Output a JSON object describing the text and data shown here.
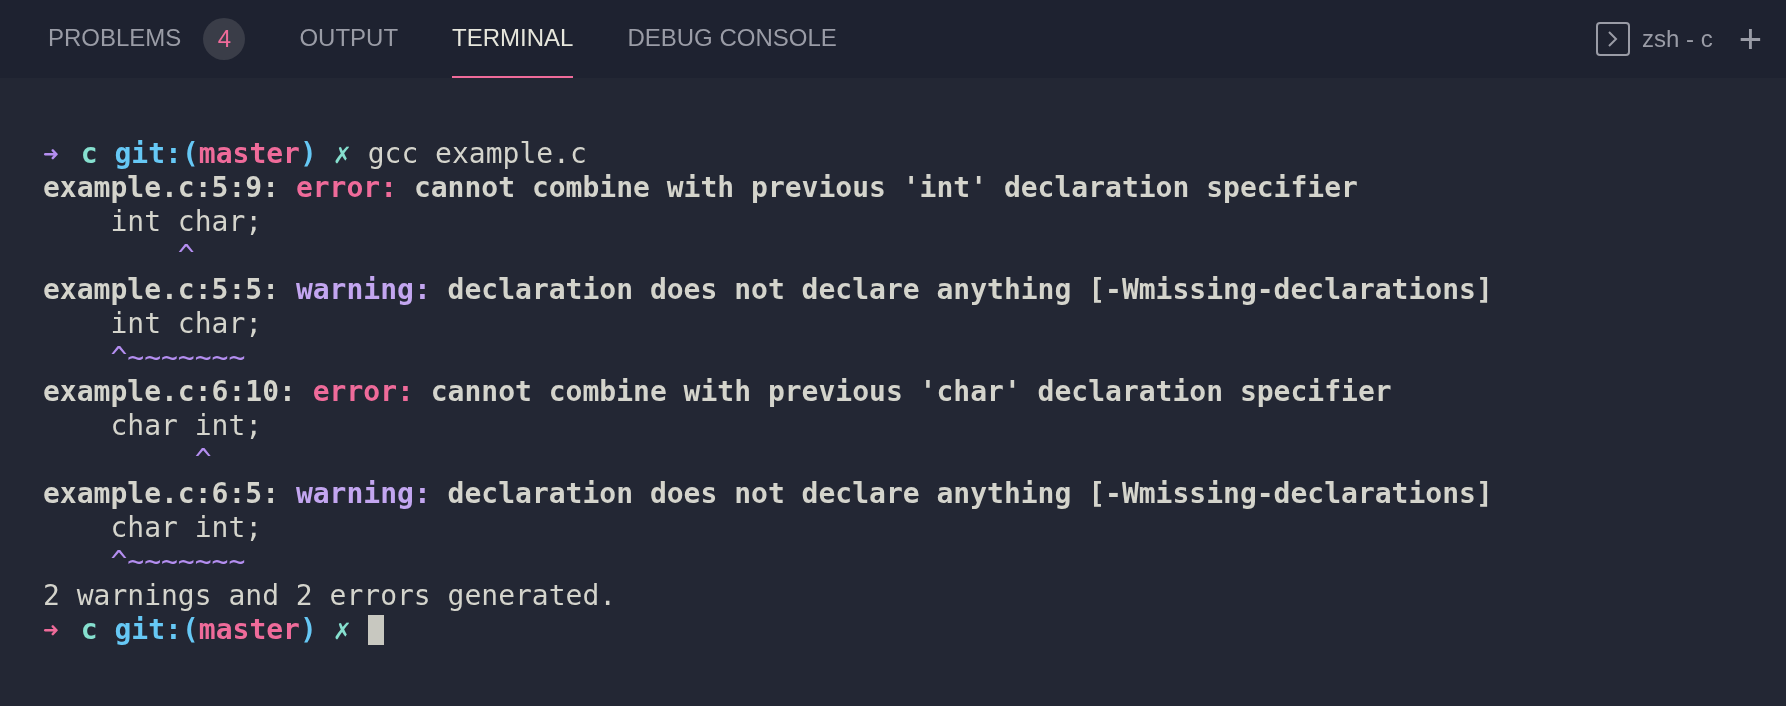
{
  "tabs": [
    {
      "label": "PROBLEMS",
      "badge": "4",
      "selected": false
    },
    {
      "label": "OUTPUT",
      "selected": false
    },
    {
      "label": "TERMINAL",
      "selected": true
    },
    {
      "label": "DEBUG CONSOLE",
      "selected": false
    }
  ],
  "terminal_selector": {
    "label": "zsh - c",
    "add": "+"
  },
  "terminal": {
    "lines": [
      {
        "kind": "prompt",
        "succeeded": true,
        "arrow": "➜",
        "directory": "c",
        "git_open": "git:(",
        "branch": "master",
        "git_close": ")",
        "dirty": "✗",
        "command": "gcc example.c"
      },
      {
        "kind": "output",
        "segments": [
          {
            "kind": "bold",
            "text": "example.c:5:9: "
          },
          {
            "kind": "error",
            "text": "error: "
          },
          {
            "kind": "bold",
            "text": "cannot combine with previous 'int' declaration specifier"
          }
        ]
      },
      {
        "kind": "output",
        "segments": [
          {
            "kind": "plain",
            "text": "    int char;"
          }
        ]
      },
      {
        "kind": "output",
        "segments": [
          {
            "kind": "marker",
            "text": "        ^"
          }
        ]
      },
      {
        "kind": "output",
        "segments": [
          {
            "kind": "bold",
            "text": "example.c:5:5: "
          },
          {
            "kind": "warning",
            "text": "warning: "
          },
          {
            "kind": "bold",
            "text": "declaration does not declare anything [-Wmissing-declarations]"
          }
        ]
      },
      {
        "kind": "output",
        "segments": [
          {
            "kind": "plain",
            "text": "    int char;"
          }
        ]
      },
      {
        "kind": "output",
        "segments": [
          {
            "kind": "marker",
            "text": "    ^~~~~~~~"
          }
        ]
      },
      {
        "kind": "output",
        "segments": [
          {
            "kind": "bold",
            "text": "example.c:6:10: "
          },
          {
            "kind": "error",
            "text": "error: "
          },
          {
            "kind": "bold",
            "text": "cannot combine with previous 'char' declaration specifier"
          }
        ]
      },
      {
        "kind": "output",
        "segments": [
          {
            "kind": "plain",
            "text": "    char int;"
          }
        ]
      },
      {
        "kind": "output",
        "segments": [
          {
            "kind": "marker",
            "text": "         ^"
          }
        ]
      },
      {
        "kind": "output",
        "segments": [
          {
            "kind": "bold",
            "text": "example.c:6:5: "
          },
          {
            "kind": "warning",
            "text": "warning: "
          },
          {
            "kind": "bold",
            "text": "declaration does not declare anything [-Wmissing-declarations]"
          }
        ]
      },
      {
        "kind": "output",
        "segments": [
          {
            "kind": "plain",
            "text": "    char int;"
          }
        ]
      },
      {
        "kind": "output",
        "segments": [
          {
            "kind": "marker",
            "text": "    ^~~~~~~~"
          }
        ]
      },
      {
        "kind": "output",
        "segments": [
          {
            "kind": "plain",
            "text": "2 warnings and 2 errors generated."
          }
        ]
      },
      {
        "kind": "prompt",
        "succeeded": false,
        "arrow": "➜",
        "directory": "c",
        "git_open": "git:(",
        "branch": "master",
        "git_close": ")",
        "dirty": "✗",
        "cursor": true
      }
    ]
  }
}
